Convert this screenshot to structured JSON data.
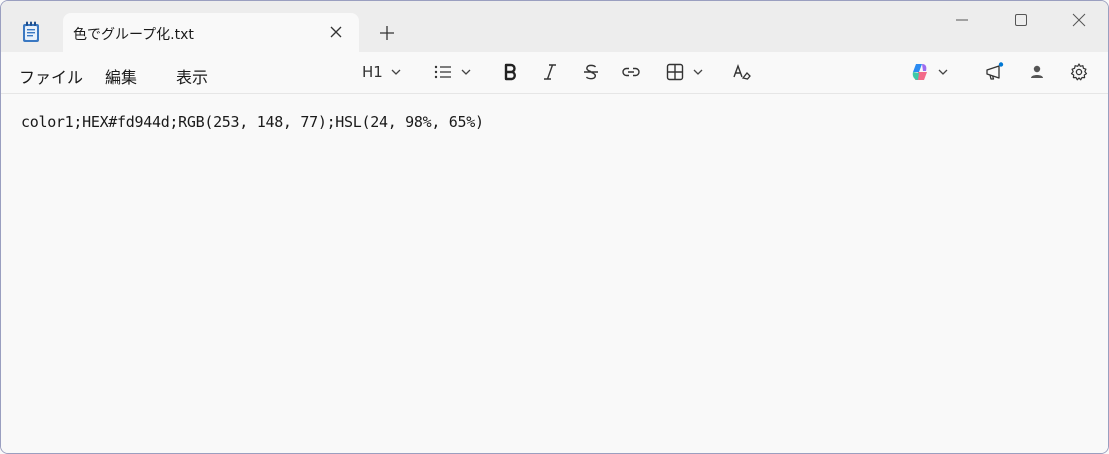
{
  "tab": {
    "title": "色でグループ化.txt"
  },
  "menu": {
    "file": "ファイル",
    "edit": "編集",
    "view": "表示"
  },
  "toolbar": {
    "heading": "H1"
  },
  "document": {
    "line1": "color1;HEX#fd944d;RGB(253, 148, 77);HSL(24, 98%, 65%)"
  },
  "colors": {
    "accent": "#0078d4",
    "notepad_blue": "#3a78c2"
  }
}
